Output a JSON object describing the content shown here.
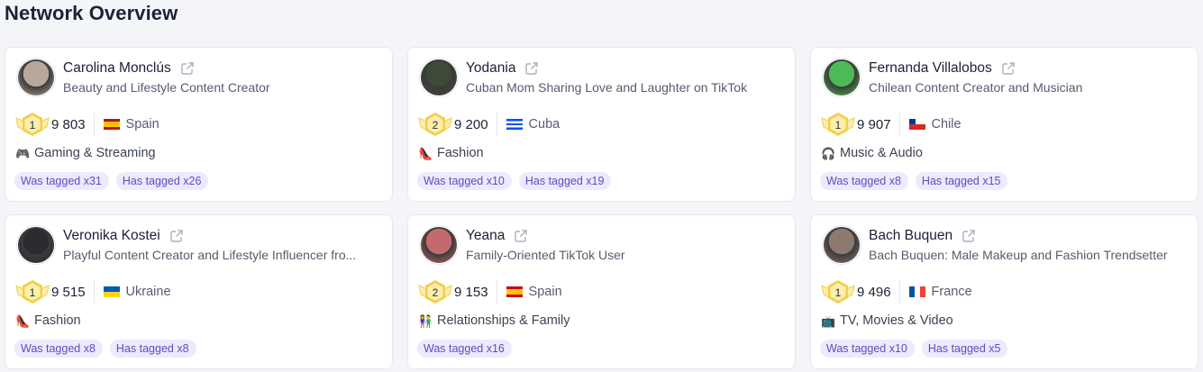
{
  "page_title": "Network Overview",
  "cards": [
    {
      "name": "Carolina Monclús",
      "description": "Beauty and Lifestyle Content Creator",
      "rank": "1",
      "followers": "9 803",
      "country": "Spain",
      "flag": "spain",
      "category_icon": "gamepad-icon",
      "category_glyph": "🎮",
      "category": "Gaming & Streaming",
      "was_tagged": "Was tagged x31",
      "has_tagged": "Has tagged x26",
      "avatar_color": "#b9a79c"
    },
    {
      "name": "Yodania",
      "description": "Cuban Mom Sharing Love and Laughter on TikTok",
      "rank": "2",
      "followers": "9 200",
      "country": "Cuba",
      "flag": "cuba",
      "category_icon": "high-heel-icon",
      "category_glyph": "👠",
      "category": "Fashion",
      "was_tagged": "Was tagged x10",
      "has_tagged": "Has tagged x19",
      "avatar_color": "#3e4a38"
    },
    {
      "name": "Fernanda Villalobos",
      "description": "Chilean Content Creator and Musician",
      "rank": "1",
      "followers": "9 907",
      "country": "Chile",
      "flag": "chile",
      "category_icon": "headphones-icon",
      "category_glyph": "🎧",
      "category": "Music & Audio",
      "was_tagged": "Was tagged x8",
      "has_tagged": "Has tagged x15",
      "avatar_color": "#4dbb55"
    },
    {
      "name": "Veronika Kostei",
      "description": "Playful Content Creator and Lifestyle Influencer fro...",
      "rank": "1",
      "followers": "9 515",
      "country": "Ukraine",
      "flag": "ukraine",
      "category_icon": "high-heel-icon",
      "category_glyph": "👠",
      "category": "Fashion",
      "was_tagged": "Was tagged x8",
      "has_tagged": "Has tagged x8",
      "avatar_color": "#2a2a30"
    },
    {
      "name": "Yeana",
      "description": "Family-Oriented TikTok User",
      "rank": "2",
      "followers": "9 153",
      "country": "Spain",
      "flag": "spain",
      "category_icon": "family-icon",
      "category_glyph": "👫",
      "category": "Relationships & Family",
      "was_tagged": "Was tagged x16",
      "has_tagged": "",
      "avatar_color": "#c46a6e"
    },
    {
      "name": "Bach Buquen",
      "description": "Bach Buquen: Male Makeup and Fashion Trendsetter",
      "rank": "1",
      "followers": "9 496",
      "country": "France",
      "flag": "france",
      "category_icon": "tv-icon",
      "category_glyph": "📺",
      "category": "TV, Movies & Video",
      "was_tagged": "Was tagged x10",
      "has_tagged": "Has tagged x5",
      "avatar_color": "#8c7a6e"
    }
  ],
  "colors": {
    "medal_gold": "#f3cf47",
    "medal_pale": "#fbeeb0",
    "badge_bg": "#eceafc",
    "badge_text": "#5a4fbf"
  }
}
